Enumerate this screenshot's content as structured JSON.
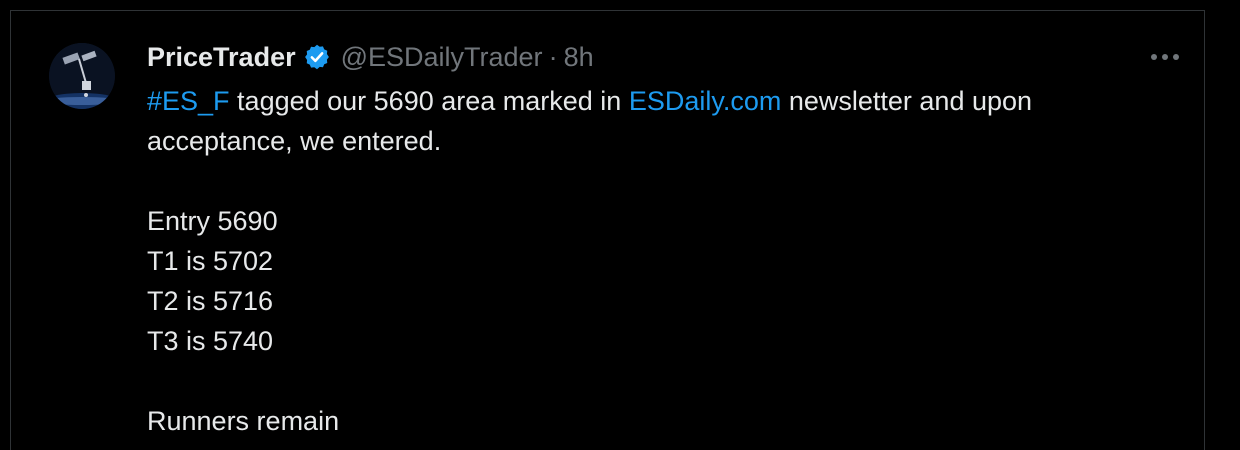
{
  "tweet": {
    "author_name": "PriceTrader",
    "handle": "@ESDailyTrader",
    "separator": "·",
    "time": "8h",
    "more_label": "···",
    "text": {
      "hashtag": "#ES_F",
      "segment_1": " tagged our 5690 area marked in ",
      "site_link": "ESDaily.com",
      "segment_2": " newsletter and upon",
      "line_2": "acceptance, we entered.",
      "entry": "Entry 5690",
      "t1": "T1 is 5702",
      "t2": "T2 is 5716",
      "t3": "T3 is 5740",
      "closing": "Runners remain"
    }
  },
  "icons": {
    "verified": "verified-badge-icon",
    "more": "more-options-icon"
  },
  "colors": {
    "background": "#000000",
    "text": "#e7e9ea",
    "muted": "#71767b",
    "link": "#1d9bf0",
    "border": "#2f3336"
  }
}
